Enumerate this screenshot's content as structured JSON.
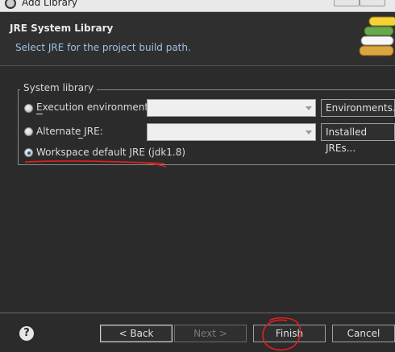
{
  "window": {
    "title": "Add Library"
  },
  "header": {
    "title": "JRE System Library",
    "description": "Select JRE for the project build path."
  },
  "group": {
    "label": "System library",
    "options": [
      {
        "label": "Execution environment:",
        "mnemonic": "E",
        "selected": false,
        "combo_value": "",
        "button": "Environments..."
      },
      {
        "label": "Alternate JRE:",
        "mnemonic": "J",
        "selected": false,
        "combo_value": "",
        "button": "Installed JREs..."
      },
      {
        "label": "Workspace default JRE (jdk1.8)",
        "mnemonic": "d",
        "selected": true
      }
    ]
  },
  "footer": {
    "help_icon": "?",
    "back": "< Back",
    "next": "Next >",
    "finish": "Finish",
    "cancel": "Cancel"
  },
  "annotations": {
    "color": "#e0201f"
  }
}
